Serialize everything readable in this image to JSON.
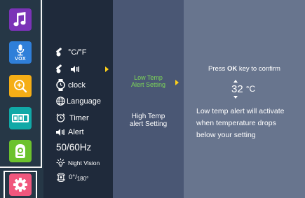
{
  "sidebar": {
    "apps": [
      {
        "name": "music",
        "color": "#7b33b7"
      },
      {
        "name": "vox",
        "label": "VOX",
        "color": "#2f7fd9"
      },
      {
        "name": "zoom",
        "color": "#f5ae16"
      },
      {
        "name": "camera-display",
        "color": "#11a9a7"
      },
      {
        "name": "baby-monitor",
        "color": "#6cc22d"
      },
      {
        "name": "settings",
        "color": "#f0577d"
      }
    ]
  },
  "menu": {
    "temp_unit": "°C/°F",
    "alert_arrow": "▶",
    "clock": "clock",
    "language": "Language",
    "timer": "Timer",
    "alert": "Alert",
    "frequency": "50/60Hz",
    "night_vision": "Night Vision",
    "rotate_a": "0°/",
    "rotate_b": "180°"
  },
  "submenu": {
    "low_line1": "Low Temp",
    "low_line2": "Alert Setting",
    "high_line1": "High Temp",
    "high_line2": "alert Setting",
    "active_color": "#7ed957"
  },
  "detail": {
    "hint_prefix": "Press ",
    "hint_key": "OK",
    "hint_suffix": " key to confirm",
    "temperature": "32",
    "unit": "°C",
    "desc_line1": "Low temp alert will activate",
    "desc_line2": "when temperature drops",
    "desc_line3": "below your setting"
  }
}
